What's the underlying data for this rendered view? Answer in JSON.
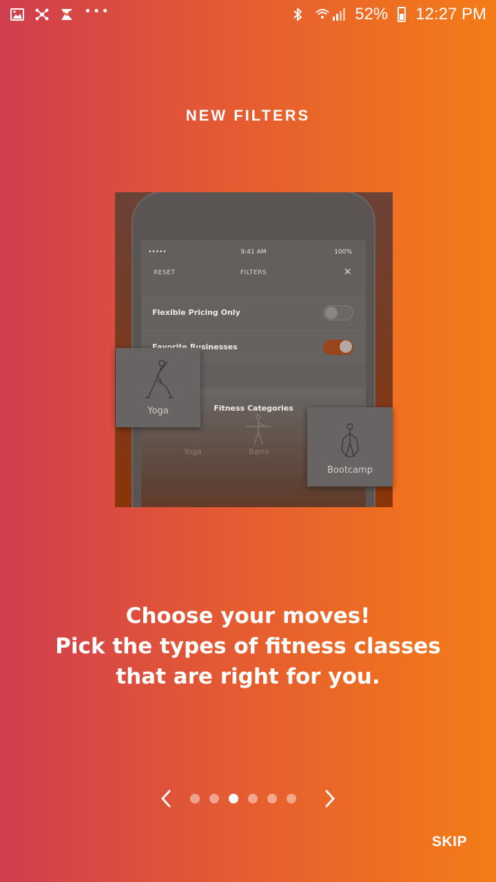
{
  "status_bar": {
    "left_icons": [
      "gallery-icon",
      "share-icon",
      "swiftkey-icon"
    ],
    "more": "•••",
    "battery": "52%",
    "time": "12:27 PM"
  },
  "title": "NEW FILTERS",
  "illustration": {
    "status_left": "•••••",
    "status_time": "9:41 AM",
    "status_battery": "100%",
    "header_reset": "RESET",
    "header_title": "FILTERS",
    "header_close": "✕",
    "rows": [
      {
        "label": "Flexible Pricing Only",
        "on": false
      },
      {
        "label": "Favorite Businesses",
        "on": true
      }
    ],
    "categories_title": "Fitness Categories",
    "mini_categories": [
      "Yoga",
      "Barre"
    ],
    "card_left": "Yoga",
    "card_right": "Bootcamp"
  },
  "caption": {
    "line1": "Choose your moves!",
    "line2": "Pick the types of fitness classes that are right for you."
  },
  "pager": {
    "total": 6,
    "active_index": 2
  },
  "skip_label": "SKIP"
}
